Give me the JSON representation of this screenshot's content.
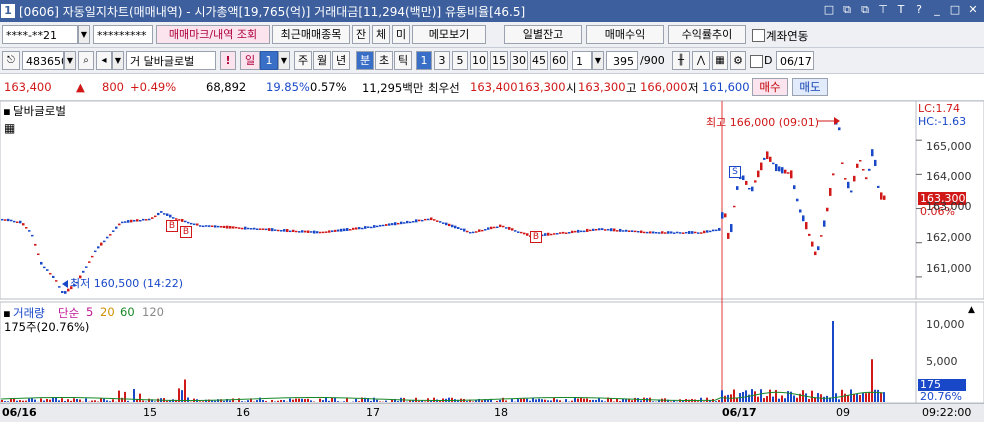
{
  "window": {
    "number": "1",
    "title": "[0606] 자동일지차트(매매내역) - 시가총액[19,765(억)] 거래대금[11,294(백만)] 유통비율[46.5]",
    "controls": [
      "□",
      "⧉",
      "⧉",
      "⊤",
      "T",
      "?",
      "_",
      "□",
      "✕"
    ]
  },
  "toolbar1": {
    "account": "****-**21",
    "password": "*********",
    "trade_mark_btn": "매매마크/내역 조회",
    "recent_btn": "최근매매종목",
    "jan": "잔",
    "che": "체",
    "mi": "미",
    "memo_btn": "메모보기",
    "daily_btn": "일별잔고",
    "profit_btn": "매매수익",
    "rate_btn": "수익률추이",
    "link_label": "계좌연동"
  },
  "toolbar2": {
    "code": "483650",
    "stock_name": "거 달바글로벌",
    "warn": "!",
    "period_sel": "일",
    "period_num": "1",
    "periods": [
      "주",
      "월",
      "년"
    ],
    "min_active": "분",
    "tick_labels": [
      "초",
      "틱"
    ],
    "min_values": [
      "1",
      "3",
      "5",
      "10",
      "15",
      "30",
      "45",
      "60"
    ],
    "interval": "1",
    "count": "395",
    "count_total": "/900",
    "date_label": "D",
    "date": "06/17"
  },
  "quote": {
    "price": "163,400",
    "arrow": "▲",
    "change": "800",
    "pct": "+0.49%",
    "volume": "68,892",
    "turnover_pct": "19.85%",
    "ratio": "0.57%",
    "amount": "11,295백만",
    "best_label": "최우선",
    "ask": "163,400",
    "bid": "163,300",
    "open_label": "시",
    "open": "163,300",
    "high_label": "고",
    "high": "166,000",
    "low_label": "저",
    "low": "161,600",
    "buy_btn": "매수",
    "sell_btn": "매도"
  },
  "price_pane": {
    "label": "달바글로벌",
    "lc": "LC:1.74",
    "hc": "HC:-1.63",
    "max_label": "최고 166,000 (09:01)",
    "min_label": "최저 160,500 (14:22)",
    "last_price": "163,300",
    "last_pct": "0.06%",
    "marker_b": "B",
    "marker_s": "S",
    "y_ticks": [
      "165,000",
      "164,000",
      "163,000",
      "162,000",
      "161,000"
    ]
  },
  "volume_pane": {
    "label": "거래량",
    "ma_label": "단순",
    "ma_periods": [
      "5",
      "20",
      "60",
      "120"
    ],
    "sub_label": "175주(20.76%)",
    "last_value": "175",
    "last_pct": "20.76%",
    "y_ticks": [
      "10,000",
      "5,000"
    ]
  },
  "x_axis": {
    "labels": [
      "06/16",
      "15",
      "16",
      "17",
      "18",
      "06/17",
      "09"
    ],
    "time": "09:22:00"
  },
  "colors": {
    "up": "#d01818",
    "down": "#1848c8",
    "title_bg": "#3d5f9e"
  },
  "chart_data": {
    "type": "candlestick",
    "price_ylim": [
      160500,
      166000
    ],
    "volume_ylim": [
      0,
      12000
    ],
    "volume_peaks": [
      {
        "label": "06/17 09",
        "value": 10800
      },
      {
        "label": "06/17 09",
        "value": 5700
      }
    ]
  }
}
